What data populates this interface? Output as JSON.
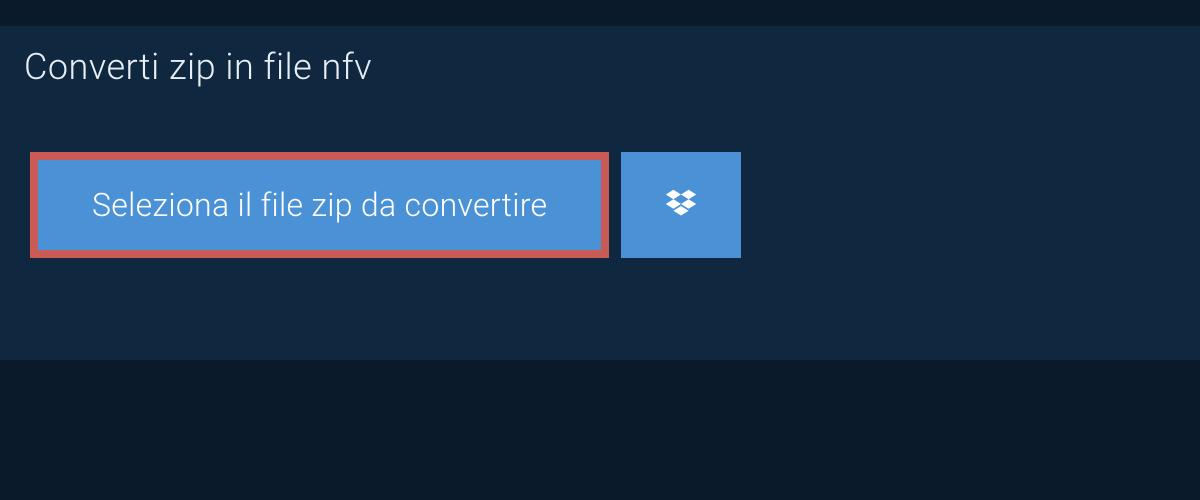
{
  "title": "Converti zip in file nfv",
  "buttons": {
    "select_file": "Seleziona il file zip da convertire"
  },
  "colors": {
    "background_dark": "#0a1a2a",
    "background_mid": "#10283f",
    "button_blue": "#4b91d6",
    "highlight_red": "#c95a55"
  }
}
